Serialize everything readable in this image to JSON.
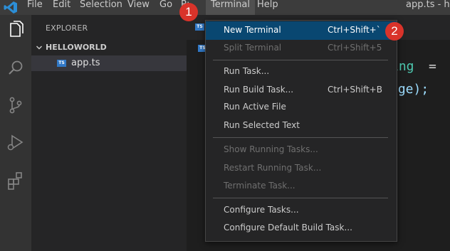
{
  "titlebar": {
    "menus": [
      "File",
      "Edit",
      "Selection",
      "View",
      "Go",
      "Run",
      "Terminal",
      "Help"
    ],
    "window_title": "app.ts - he"
  },
  "activity": {
    "icons": [
      "explorer-icon",
      "search-icon",
      "source-control-icon",
      "run-debug-icon",
      "extensions-icon"
    ]
  },
  "explorer": {
    "title": "EXPLORER",
    "folder": "HELLOWORLD",
    "file": {
      "badge": "TS",
      "name": "app.ts"
    }
  },
  "editor": {
    "tab_badges": [
      "TS",
      "TS"
    ],
    "code_fragments": [
      "ing",
      "=",
      "age);"
    ]
  },
  "terminal_menu": {
    "items": [
      {
        "label": "New Terminal",
        "shortcut": "Ctrl+Shift+`",
        "disabled": false,
        "highlighted": true
      },
      {
        "label": "Split Terminal",
        "shortcut": "Ctrl+Shift+5",
        "disabled": true
      },
      {
        "label": "Run Task...",
        "shortcut": "",
        "disabled": false
      },
      {
        "label": "Run Build Task...",
        "shortcut": "Ctrl+Shift+B",
        "disabled": false
      },
      {
        "label": "Run Active File",
        "shortcut": "",
        "disabled": false
      },
      {
        "label": "Run Selected Text",
        "shortcut": "",
        "disabled": false
      },
      {
        "label": "Show Running Tasks...",
        "shortcut": "",
        "disabled": true
      },
      {
        "label": "Restart Running Task...",
        "shortcut": "",
        "disabled": true
      },
      {
        "label": "Terminate Task...",
        "shortcut": "",
        "disabled": true
      },
      {
        "label": "Configure Tasks...",
        "shortcut": "",
        "disabled": false
      },
      {
        "label": "Configure Default Build Task...",
        "shortcut": "",
        "disabled": false
      }
    ]
  },
  "annotations": {
    "step1": "1",
    "step2": "2"
  },
  "colors": {
    "accent": "#094771",
    "step_badge": "#d9332a",
    "ts_badge": "#3178c6"
  }
}
